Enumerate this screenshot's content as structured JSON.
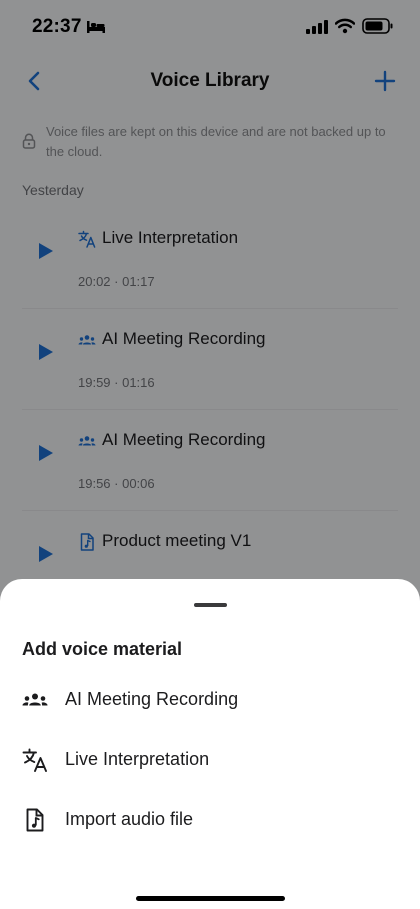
{
  "status_bar": {
    "time": "22:37"
  },
  "nav": {
    "title": "Voice Library"
  },
  "notice": {
    "text": "Voice files are kept on this device and are not backed up to the cloud."
  },
  "section": {
    "label": "Yesterday"
  },
  "recordings": [
    {
      "icon": "translate-icon",
      "title": "Live Interpretation",
      "meta": "20:02 · 01:17"
    },
    {
      "icon": "people-icon",
      "title": "AI Meeting Recording",
      "meta": "19:59 · 01:16"
    },
    {
      "icon": "people-icon",
      "title": "AI Meeting Recording",
      "meta": "19:56 · 00:06"
    },
    {
      "icon": "audio-file-icon",
      "title": "Product meeting V1",
      "meta": ""
    }
  ],
  "sheet": {
    "title": "Add voice material",
    "options": [
      {
        "icon": "people-icon",
        "label": "AI Meeting Recording"
      },
      {
        "icon": "translate-icon",
        "label": "Live Interpretation"
      },
      {
        "icon": "audio-file-icon",
        "label": "Import audio file"
      }
    ]
  },
  "colors": {
    "accent": "#1f6fd1",
    "overlay": "rgba(0,0,0,0.40)"
  }
}
